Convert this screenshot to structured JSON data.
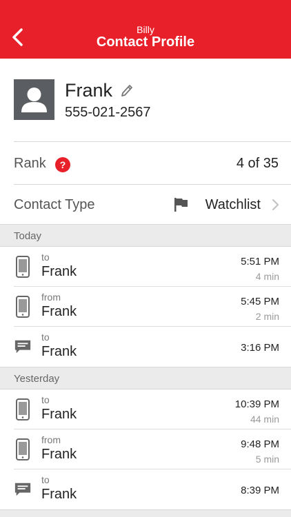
{
  "header": {
    "subtitle": "Billy",
    "title": "Contact Profile",
    "accent": "#e8202a"
  },
  "contact": {
    "name": "Frank",
    "phone": "555-021-2567"
  },
  "rank": {
    "label": "Rank",
    "help": "?",
    "value": "4 of 35"
  },
  "contact_type": {
    "label": "Contact Type",
    "value": "Watchlist",
    "icon": "flag-icon"
  },
  "sections": [
    {
      "title": "Today",
      "items": [
        {
          "kind": "phone",
          "direction": "to",
          "name": "Frank",
          "time": "5:51 PM",
          "duration": "4 min"
        },
        {
          "kind": "phone",
          "direction": "from",
          "name": "Frank",
          "time": "5:45 PM",
          "duration": "2 min"
        },
        {
          "kind": "message",
          "direction": "to",
          "name": "Frank",
          "time": "3:16 PM",
          "duration": ""
        }
      ]
    },
    {
      "title": "Yesterday",
      "items": [
        {
          "kind": "phone",
          "direction": "to",
          "name": "Frank",
          "time": "10:39 PM",
          "duration": "44 min"
        },
        {
          "kind": "phone",
          "direction": "from",
          "name": "Frank",
          "time": "9:48 PM",
          "duration": "5 min"
        },
        {
          "kind": "message",
          "direction": "to",
          "name": "Frank",
          "time": "8:39 PM",
          "duration": ""
        }
      ]
    }
  ]
}
